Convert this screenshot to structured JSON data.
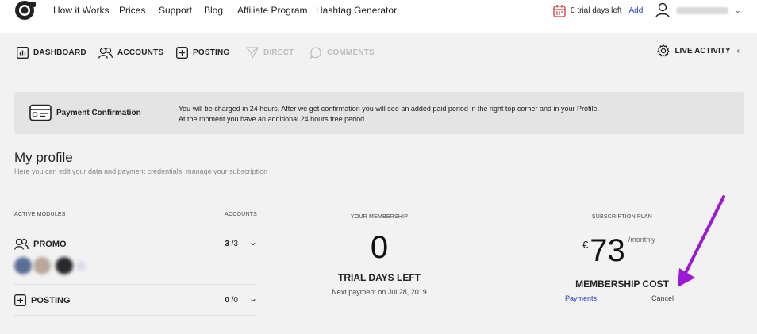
{
  "nav": {
    "items": [
      "How it Works",
      "Prices",
      "Support",
      "Blog",
      "Affiliate Program",
      "Hashtag Generator"
    ]
  },
  "trial": {
    "text": "0 trial days left",
    "add_label": "Add"
  },
  "toolbar": {
    "dashboard": "DASHBOARD",
    "accounts": "ACCOUNTS",
    "posting": "POSTING",
    "direct": "DIRECT",
    "comments": "COMMENTS",
    "live_activity": "LIVE ACTIVITY"
  },
  "notice": {
    "title": "Payment Confirmation",
    "line1": "You will be charged in 24 hours. After we get confirmation you will see an added paid period in the right top corner and in your Profile.",
    "line2": "At the moment you have an additional 24 hours free period"
  },
  "profile": {
    "title": "My profile",
    "subtitle": "Here you can edit your data and payment credentials, manage your subscription"
  },
  "modules": {
    "head_left": "ACTIVE MODULES",
    "head_right": "ACCOUNTS",
    "rows": [
      {
        "name": "PROMO",
        "used": "3",
        "total": "/3"
      },
      {
        "name": "POSTING",
        "used": "0",
        "total": "/0"
      }
    ]
  },
  "membership": {
    "label": "YOUR MEMBERSHIP",
    "value": "0",
    "caption": "TRIAL DAYS LEFT",
    "next_payment": "Next payment on Jul 28, 2019"
  },
  "plan": {
    "label": "SUBSCRIPTION PLAN",
    "currency": "€",
    "price": "73",
    "period": "/monthly",
    "caption": "MEMBERSHIP COST",
    "payments_link": "Payments",
    "cancel_link": "Cancel"
  },
  "colors": {
    "accent": "#2a3bbd",
    "annotation_arrow": "#9b19d6",
    "calendar_red": "#d63a3a"
  }
}
